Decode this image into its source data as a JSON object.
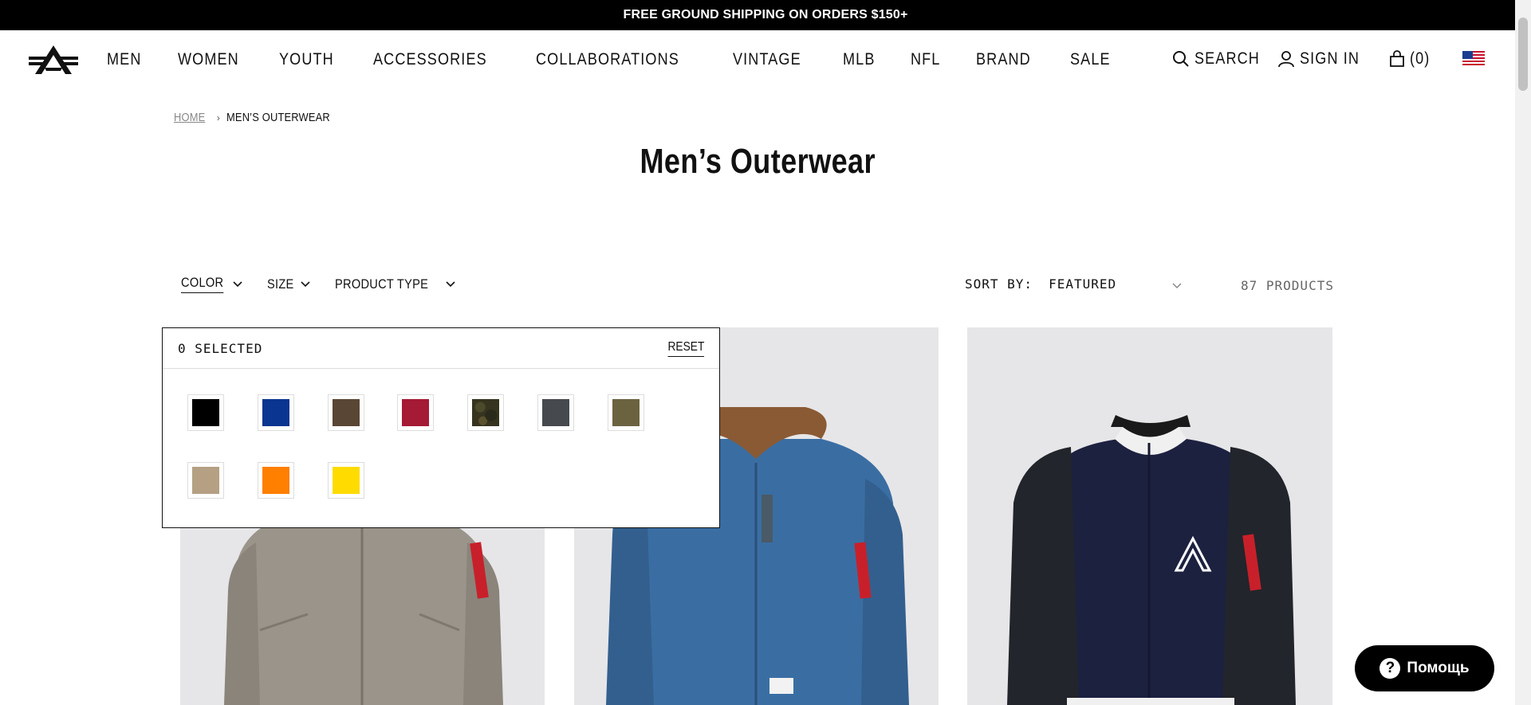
{
  "promo": {
    "text": "FREE GROUND SHIPPING ON ORDERS $150+"
  },
  "nav": {
    "items": [
      "MEN",
      "WOMEN",
      "YOUTH",
      "ACCESSORIES",
      "COLLABORATIONS",
      "VINTAGE",
      "MLB",
      "NFL",
      "BRAND",
      "SALE"
    ]
  },
  "utils": {
    "search": "SEARCH",
    "signin": "SIGN IN",
    "cart": "(0)"
  },
  "breadcrumb": {
    "home": "HOME",
    "sep": "›",
    "current": "MEN’S OUTERWEAR"
  },
  "page": {
    "title": "Men’s Outerwear"
  },
  "filters": {
    "color": "COLOR",
    "size": "SIZE",
    "product_type": "PRODUCT TYPE"
  },
  "sort": {
    "label": "SORT BY:",
    "value": "FEATURED"
  },
  "count": "87 PRODUCTS",
  "color_dropdown": {
    "selected": "0 SELECTED",
    "reset": "RESET",
    "swatches": [
      "#000000",
      "#0a3590",
      "#5a4634",
      "#a51a35",
      "camo",
      "#46494d",
      "#6b6340",
      "#b5a084",
      "#ff7f00",
      "#ffdb00"
    ]
  },
  "help": {
    "label": "Помощь",
    "icon": "?"
  },
  "colors": {
    "accent": "#000000",
    "card_bg": "#e6e6e8"
  }
}
